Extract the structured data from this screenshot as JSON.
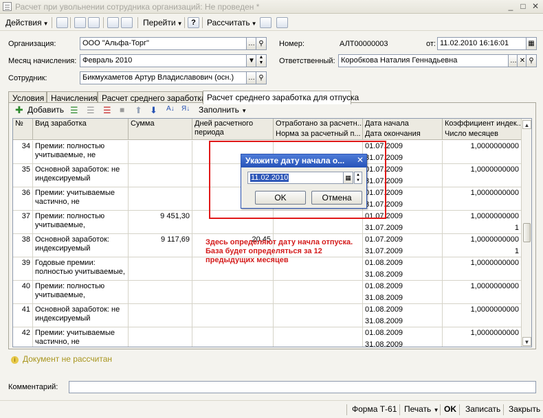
{
  "window": {
    "title": "Расчет при увольнении сотрудника организаций: Не проведен *"
  },
  "toolbar": {
    "actions": "Действия",
    "goto": "Перейти",
    "help": "?",
    "calculate": "Рассчитать"
  },
  "form": {
    "org_label": "Организация:",
    "org_value": "ООО \"Альфа-Торг\"",
    "month_label": "Месяц начисления:",
    "month_value": "Февраль 2010",
    "employee_label": "Сотрудник:",
    "employee_value": "Бикмухаметов Артур Владиславович (осн.)",
    "number_label": "Номер:",
    "number_value": "АЛТ00000003",
    "date_label": "от:",
    "date_value": "11.02.2010 16:16:01",
    "responsible_label": "Ответственный:",
    "responsible_value": "Коробкова Наталия Геннадьевна"
  },
  "tabs": [
    {
      "label": "Условия"
    },
    {
      "label": "Начисления"
    },
    {
      "label": "Расчет среднего заработка"
    },
    {
      "label": "Расчет среднего заработка для отпуска"
    }
  ],
  "grid_toolbar": {
    "add": "Добавить",
    "fill": "Заполнить"
  },
  "grid": {
    "headers": {
      "num": "№",
      "kind": "Вид заработка",
      "sum": "Сумма",
      "days": "Дней расчетного периода",
      "worked": "Отработано за расчетн...",
      "norm": "Норма за расчетный п...",
      "start": "Дата начала",
      "end": "Дата окончания",
      "coef": "Коэффициент индек...",
      "months": "Число месяцев"
    },
    "rows": [
      {
        "n": "34",
        "kind": "Премии: полностью учитываемые, не",
        "sum": "",
        "days": "",
        "start": "01.07.2009",
        "end": "31.07.2009",
        "coef": "1,0000000000",
        "months": ""
      },
      {
        "n": "35",
        "kind": "Основной заработок: не индексируемый",
        "sum": "",
        "days": "",
        "start": "01.07.2009",
        "end": "31.07.2009",
        "coef": "1,0000000000",
        "months": ""
      },
      {
        "n": "36",
        "kind": "Премии: учитываемые частично, не",
        "sum": "",
        "days": "",
        "start": "01.07.2009",
        "end": "31.07.2009",
        "coef": "1,0000000000",
        "months": ""
      },
      {
        "n": "37",
        "kind": "Премии: полностью учитываемые,",
        "sum": "9 451,30",
        "days": "",
        "start": "01.07.2009",
        "end": "31.07.2009",
        "coef": "1,0000000000",
        "months": "1"
      },
      {
        "n": "38",
        "kind": "Основной заработок: индексируемый",
        "sum": "9 117,69",
        "days": "20,45",
        "start": "01.07.2009",
        "end": "31.07.2009",
        "coef": "1,0000000000",
        "months": "1"
      },
      {
        "n": "39",
        "kind": "Годовые премии: полностью учитываемые,",
        "sum": "",
        "days": "",
        "start": "01.08.2009",
        "end": "31.08.2009",
        "coef": "1,0000000000",
        "months": ""
      },
      {
        "n": "40",
        "kind": "Премии: полностью учитываемые,",
        "sum": "",
        "days": "",
        "start": "01.08.2009",
        "end": "31.08.2009",
        "coef": "1,0000000000",
        "months": ""
      },
      {
        "n": "41",
        "kind": "Основной заработок: не индексируемый",
        "sum": "",
        "days": "",
        "start": "01.08.2009",
        "end": "31.08.2009",
        "coef": "1,0000000000",
        "months": ""
      },
      {
        "n": "42",
        "kind": "Премии: учитываемые частично, не",
        "sum": "",
        "days": "",
        "start": "01.08.2009",
        "end": "31.08.2009",
        "coef": "1,0000000000",
        "months": ""
      }
    ]
  },
  "status": {
    "not_calculated": "Документ не рассчитан"
  },
  "comment": {
    "label": "Комментарий:",
    "value": ""
  },
  "bottom": {
    "form_t61": "Форма Т-61",
    "print": "Печать",
    "ok": "OK",
    "save": "Записать",
    "close": "Закрыть"
  },
  "dialog": {
    "title": "Укажите дату начала о...",
    "date_value": "11.02.2010",
    "ok": "OK",
    "cancel": "Отмена"
  },
  "annotation": {
    "text1": "Здесь определяют дату начла отпуска.",
    "text2": "База будет определяться за 12",
    "text3": "предыдущих месяцев"
  },
  "colors": {
    "annotation": "#D41C1C",
    "highlight_box": "#E01818",
    "dialog_title": "#2653B8",
    "status": "#A8951E"
  }
}
